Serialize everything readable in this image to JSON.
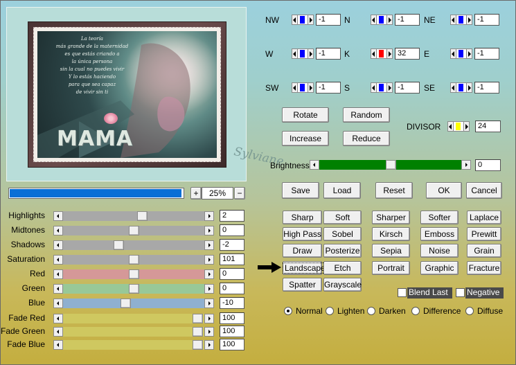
{
  "grid": {
    "cells": [
      {
        "label": "NW",
        "value": "-1",
        "color": "#0000ff"
      },
      {
        "label": "N",
        "value": "-1",
        "color": "#0000ff"
      },
      {
        "label": "NE",
        "value": "-1",
        "color": "#0000ff"
      },
      {
        "label": "W",
        "value": "-1",
        "color": "#0000ff"
      },
      {
        "label": "K",
        "value": "32",
        "color": "#ff0000"
      },
      {
        "label": "E",
        "value": "-1",
        "color": "#0000ff"
      },
      {
        "label": "SW",
        "value": "-1",
        "color": "#0000ff"
      },
      {
        "label": "S",
        "value": "-1",
        "color": "#0000ff"
      },
      {
        "label": "SE",
        "value": "-1",
        "color": "#0000ff"
      }
    ]
  },
  "buttons": {
    "rotate": "Rotate",
    "random": "Random",
    "increase": "Increase",
    "reduce": "Reduce",
    "save": "Save",
    "load": "Load",
    "reset": "Reset",
    "ok": "OK",
    "cancel": "Cancel"
  },
  "divisor": {
    "label": "DIVISOR",
    "value": "24",
    "color": "#ffff00"
  },
  "brightness": {
    "label": "Brightness",
    "value": "0",
    "fraction": 0.5,
    "color": "#008000"
  },
  "zoom": {
    "value": "25%",
    "plus": "+",
    "minus": "−",
    "progress": 0.99,
    "color": "#0a6fd6"
  },
  "preview": {
    "poem": [
      "La teoría",
      "más grande de la maternidad",
      "es que estás criando a",
      "la única persona",
      "sin la cual no puedes vivir",
      "Y lo estás haciendo",
      "para que sea capaz",
      "de vivir sin ti"
    ],
    "title": "MAMA",
    "signature": "Sylviane"
  },
  "adjust": [
    {
      "label": "Highlights",
      "value": "2",
      "fraction": 0.56,
      "track": "#a8a8a8"
    },
    {
      "label": "Midtones",
      "value": "0",
      "fraction": 0.5,
      "track": "#a8a8a8"
    },
    {
      "label": "Shadows",
      "value": "-2",
      "fraction": 0.39,
      "track": "#a8a8a8"
    },
    {
      "label": "Saturation",
      "value": "101",
      "fraction": 0.5,
      "track": "#a8a8a8"
    },
    {
      "label": "Red",
      "value": "0",
      "fraction": 0.5,
      "track": "#d59898"
    },
    {
      "label": "Green",
      "value": "0",
      "fraction": 0.5,
      "track": "#98c898"
    },
    {
      "label": "Blue",
      "value": "-10",
      "fraction": 0.44,
      "track": "#8fb0d0"
    },
    {
      "label": "Fade Red",
      "value": "100",
      "fraction": 0.95,
      "track": "#cfc860"
    },
    {
      "label": "Fade Green",
      "value": "100",
      "fraction": 0.95,
      "track": "#cfc860"
    },
    {
      "label": "Fade Blue",
      "value": "100",
      "fraction": 0.95,
      "track": "#cfc860"
    }
  ],
  "presets": [
    "Sharp",
    "Soft",
    "Sharper",
    "Softer",
    "Laplace",
    "High Pass",
    "Sobel",
    "Kirsch",
    "Emboss",
    "Prewitt",
    "Draw",
    "Posterize",
    "Sepia",
    "Noise",
    "Grain",
    "Landscape",
    "Etch",
    "Portrait",
    "Graphic",
    "Fracture",
    "Spatter",
    "Grayscale"
  ],
  "checks": {
    "blend_last": "Blend Last",
    "negative": "Negative"
  },
  "modes": {
    "items": [
      "Normal",
      "Lighten",
      "Darken",
      "Difference",
      "Diffuse"
    ],
    "selected": "Normal"
  }
}
